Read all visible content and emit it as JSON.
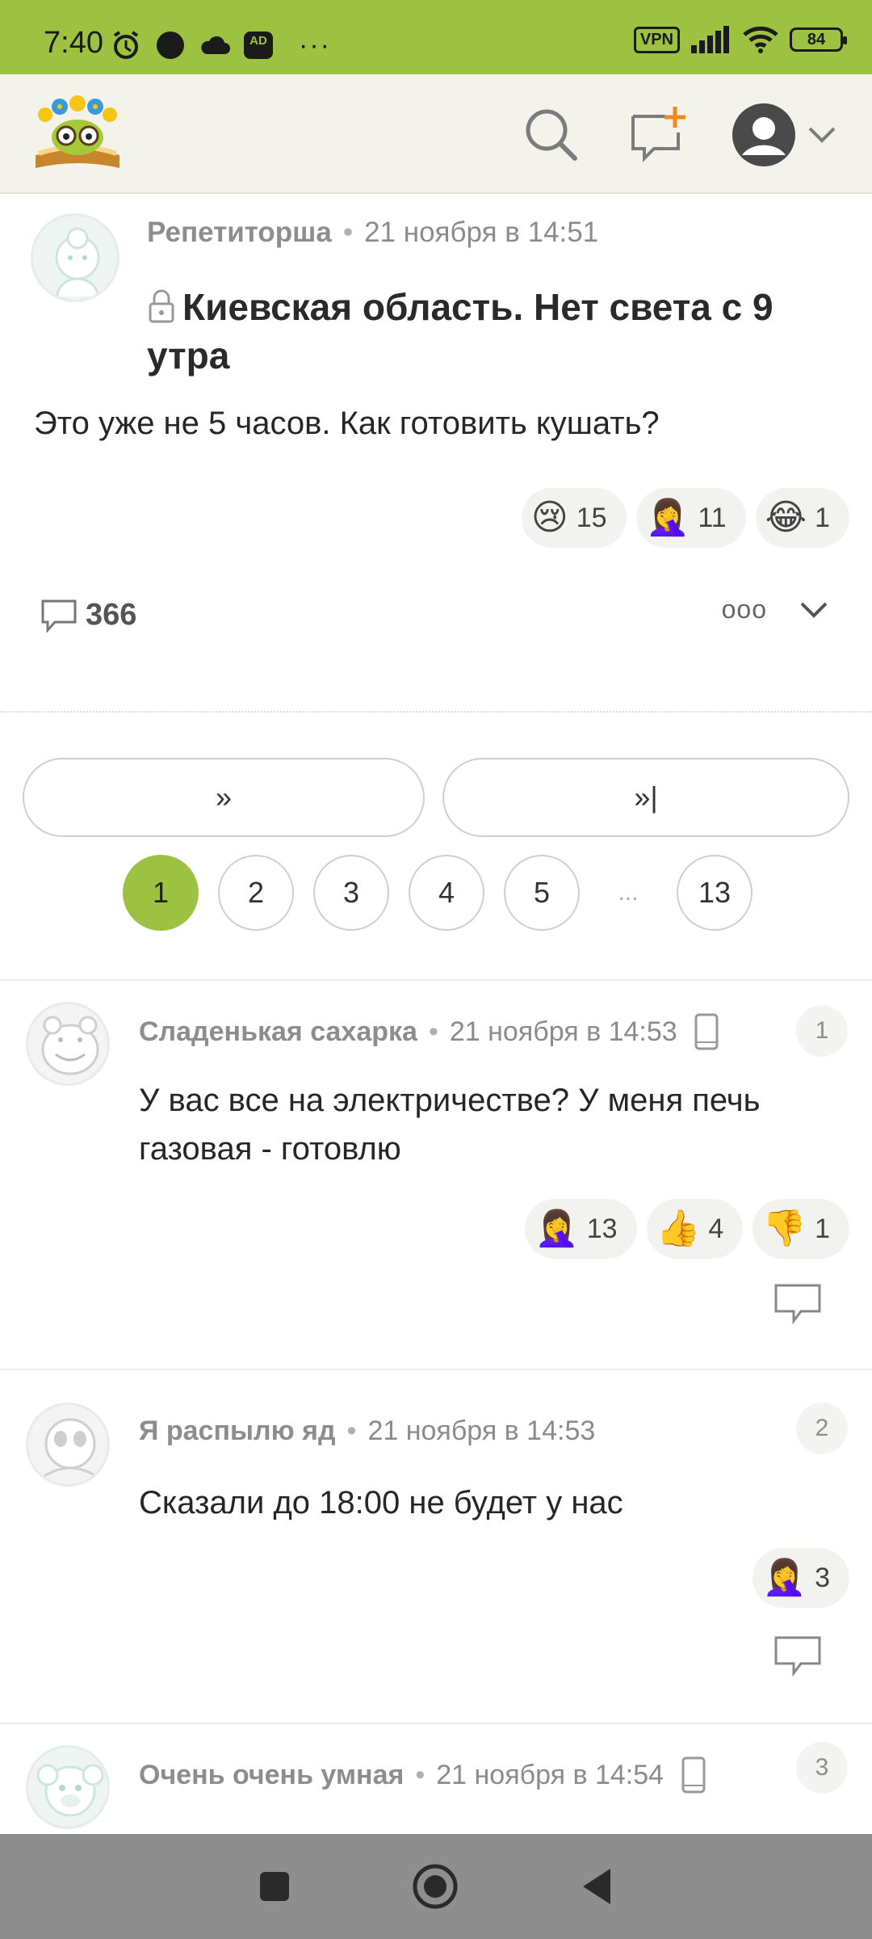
{
  "status_bar": {
    "time": "7:40",
    "ad_badge": "AD",
    "more": "···",
    "vpn": "VPN",
    "battery": "84"
  },
  "header": {
    "icons": [
      "logo",
      "search-icon",
      "new-post-icon",
      "account-icon",
      "chevron-down-icon"
    ]
  },
  "post": {
    "author": "Репетиторша",
    "time": "21 ноября в 14:51",
    "title": "Киевская область. Нет света с 9 утра",
    "body": "Это уже не 5 часов. Как готовить кушать?",
    "reactions": [
      {
        "emoji": "😢",
        "count": "15"
      },
      {
        "emoji": "🤦‍♀️",
        "count": "11"
      },
      {
        "emoji": "😂",
        "count": "1"
      }
    ],
    "comments_count": "366",
    "more": "ooo"
  },
  "pagination": {
    "next": "»",
    "last": "»|",
    "pages": [
      "1",
      "2",
      "3",
      "4",
      "5",
      "...",
      "13"
    ],
    "active": "1"
  },
  "comments": [
    {
      "author": "Сладенькая сахарка",
      "time": "21 ноября в 14:53",
      "number": "1",
      "text": "У вас все на электричестве? У меня печь газовая - готовлю",
      "reactions": [
        {
          "emoji": "🤦‍♀️",
          "count": "13"
        },
        {
          "emoji": "👍",
          "count": "4"
        },
        {
          "emoji": "👎",
          "count": "1"
        }
      ]
    },
    {
      "author": "Я распылю яд",
      "time": "21 ноября в 14:53",
      "number": "2",
      "text": "Сказали до 18:00 не будет у нас",
      "reactions": [
        {
          "emoji": "🤦‍♀️",
          "count": "3"
        }
      ]
    },
    {
      "author": "Очень очень умная",
      "time": "21 ноября в 14:54",
      "number": "3",
      "text": ""
    }
  ]
}
